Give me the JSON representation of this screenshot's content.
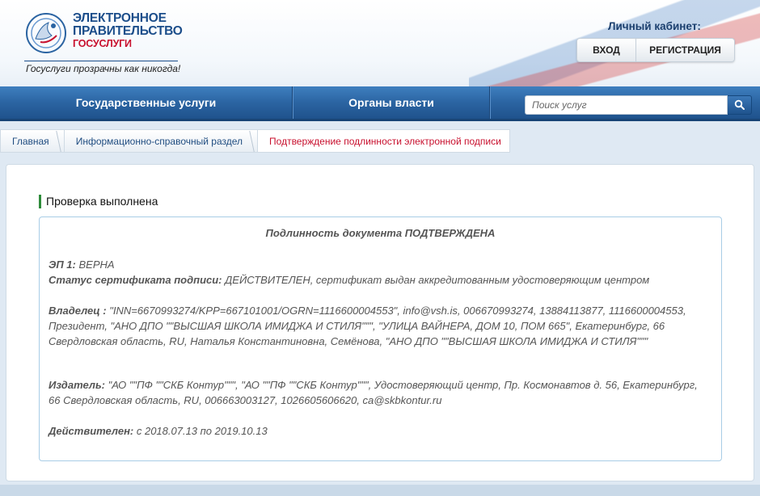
{
  "header": {
    "logo_line1": "ЭЛЕКТРОННОЕ",
    "logo_line2": "ПРАВИТЕЛЬСТВО",
    "logo_line3": "ГОСУСЛУГИ",
    "slogan": "Госуслуги прозрачны как никогда!",
    "cabinet_title": "Личный кабинет:",
    "login_label": "ВХОД",
    "register_label": "РЕГИСТРАЦИЯ"
  },
  "nav": {
    "services_label": "Государственные услуги",
    "authorities_label": "Органы власти",
    "search_placeholder": "Поиск услуг"
  },
  "breadcrumb": {
    "home": "Главная",
    "info_section": "Информационно-справочный раздел",
    "current": "Подтверждение подлинности электронной подписи"
  },
  "result": {
    "status": "Проверка выполнена",
    "title": "Подлинность документа ПОДТВЕРЖДЕНА",
    "sig_label": "ЭП 1:",
    "sig_value": " ВЕРНА",
    "cert_status_label": "Статус сертификата подписи:",
    "cert_status_value": " ДЕЙСТВИТЕЛЕН, сертификат выдан аккредитованным удостоверяющим центром",
    "owner_label": "Владелец :",
    "owner_value": " \"INN=6670993274/KPP=667101001/OGRN=1116600004553\", info@vsh.is, 006670993274, 13884113877, 1116600004553, Президент, \"АНО ДПО \"\"ВЫСШАЯ ШКОЛА ИМИДЖА И СТИЛЯ\"\"\", \"УЛИЦА ВАЙНЕРА, ДОМ 10, ПОМ 665\", Екатеринбург, 66 Свердловская область, RU, Наталья Константиновна, Семёнова, \"АНО ДПО \"\"ВЫСШАЯ ШКОЛА ИМИДЖА И СТИЛЯ\"\"\"",
    "issuer_label": "Издатель:",
    "issuer_value": " \"АО \"\"ПФ \"\"СКБ Контур\"\"\", \"АО \"\"ПФ \"\"СКБ Контур\"\"\", Удостоверяющий центр, Пр. Космонавтов д. 56, Екатеринбург, 66 Свердловская область, RU, 006663003127, 1026605606620, ca@skbkontur.ru",
    "valid_label": "Действителен:",
    "valid_value": " с 2018.07.13 по 2019.10.13"
  },
  "colors": {
    "brand_blue": "#1b4d8a",
    "brand_red": "#c8102e",
    "status_green": "#2e8b3a"
  }
}
